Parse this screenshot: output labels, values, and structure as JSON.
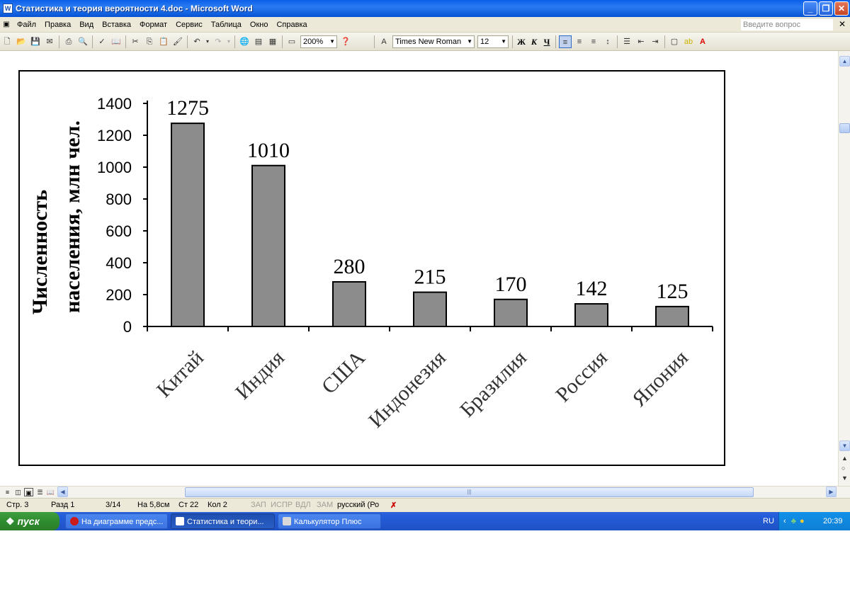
{
  "window": {
    "title": "Статистика и теория вероятности 4.doc - Microsoft Word"
  },
  "menu": {
    "items": [
      "Файл",
      "Правка",
      "Вид",
      "Вставка",
      "Формат",
      "Сервис",
      "Таблица",
      "Окно",
      "Справка"
    ],
    "help_placeholder": "Введите вопрос"
  },
  "toolbar": {
    "zoom": "200%",
    "font_name": "Times New Roman",
    "font_size": "12",
    "bold_label": "Ж",
    "italic_label": "К",
    "underline_label": "Ч"
  },
  "chart_data": {
    "type": "bar",
    "categories": [
      "Китай",
      "Индия",
      "США",
      "Индонезия",
      "Бразилия",
      "Россия",
      "Япония"
    ],
    "values": [
      1275,
      1010,
      280,
      215,
      170,
      142,
      125
    ],
    "data_labels": [
      "1275",
      "1010",
      "280",
      "215",
      "170",
      "142",
      "125"
    ],
    "ylabel_line1": "Численность",
    "ylabel_line2": "населения, млн чел.",
    "yticks": [
      "0",
      "200",
      "400",
      "600",
      "800",
      "1000",
      "1200",
      "1400"
    ],
    "ylim": [
      0,
      1400
    ],
    "bar_color": "#8c8c8c",
    "grid": false
  },
  "statusbar": {
    "page": "Стр. 3",
    "section": "Разд 1",
    "pages": "3/14",
    "at": "На 5,8см",
    "line": "Ст 22",
    "col": "Кол 2",
    "rec": "ЗАП",
    "trk": "ИСПР",
    "ext": "ВДЛ",
    "ovr": "ЗАМ",
    "lang": "русский (Ро"
  },
  "taskbar": {
    "start": "пуск",
    "tasks": [
      "На диаграмме предс...",
      "Статистика и теори...",
      "Калькулятор Плюс"
    ],
    "lang": "RU",
    "clock": "20:39"
  }
}
